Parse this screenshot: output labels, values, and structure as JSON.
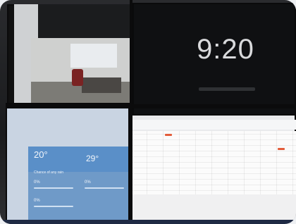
{
  "screen_clock": {
    "time": "9:20"
  },
  "weather": {
    "temp_primary": "20°",
    "temp_secondary": "29°",
    "section_title": "Chance of any rain",
    "percent_1": "0%",
    "percent_2": "0%",
    "percent_3": "0%"
  }
}
